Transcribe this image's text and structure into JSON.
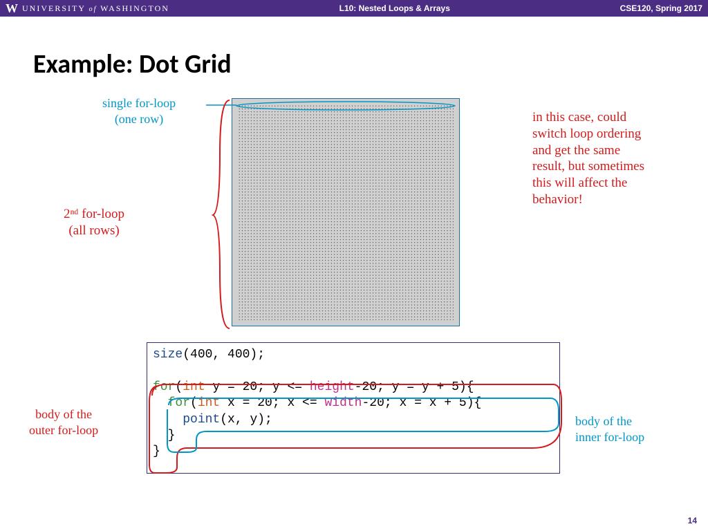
{
  "header": {
    "logo_letter": "W",
    "university": "UNIVERSITY",
    "of": "of",
    "uni2": "WASHINGTON",
    "lecture": "L10:  Nested Loops & Arrays",
    "course": "CSE120, Spring 2017"
  },
  "title": "Example:  Dot Grid",
  "annotations": {
    "single_loop": "single for-loop\n(one row)",
    "second_loop": "2ⁿᵈ for-loop\n(all rows)",
    "right_note": "in this case, could\nswitch loop ordering\nand get the same\nresult, but sometimes\nthis will affect the\nbehavior!",
    "body_outer": "body of the\nouter for-loop",
    "body_inner": "body of the\ninner for-loop"
  },
  "code": {
    "fn_size": "size",
    "args_size": "(400, 400);",
    "kw_for": "for",
    "ty_int": "int",
    "l2a": "(",
    "l2b": " y = 20; y <= ",
    "var_height": "height",
    "l2c": "-20; y = y + 5){",
    "l3a": "  ",
    "l3b": "(",
    "l3c": " x = 20; x <= ",
    "var_width": "width",
    "l3d": "-20; x = x + 5){",
    "l4a": "    ",
    "fn_point": "point",
    "l4b": "(x, y);",
    "l5": "  }",
    "l6": "}"
  },
  "page": "14"
}
